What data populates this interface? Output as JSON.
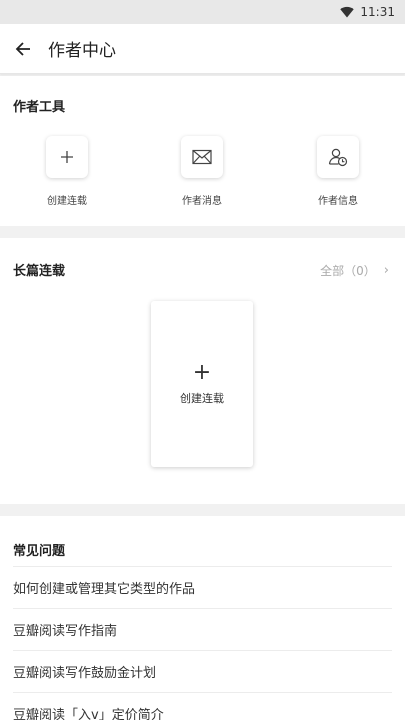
{
  "status_bar": {
    "time": "11:31",
    "wifi_icon": "wifi-icon"
  },
  "header": {
    "title": "作者中心",
    "back_icon": "back-arrow-icon"
  },
  "tools": {
    "title": "作者工具",
    "items": [
      {
        "label": "创建连载",
        "icon": "plus-icon"
      },
      {
        "label": "作者消息",
        "icon": "mail-icon"
      },
      {
        "label": "作者信息",
        "icon": "user-clock-icon"
      }
    ]
  },
  "serials": {
    "title": "长篇连载",
    "see_all": "全部（0）",
    "create_label": "创建连载"
  },
  "faq": {
    "title": "常见问题",
    "items": [
      "如何创建或管理其它类型的作品",
      "豆瓣阅读写作指南",
      "豆瓣阅读写作鼓励金计划",
      "豆瓣阅读「入v」定价简介"
    ]
  }
}
